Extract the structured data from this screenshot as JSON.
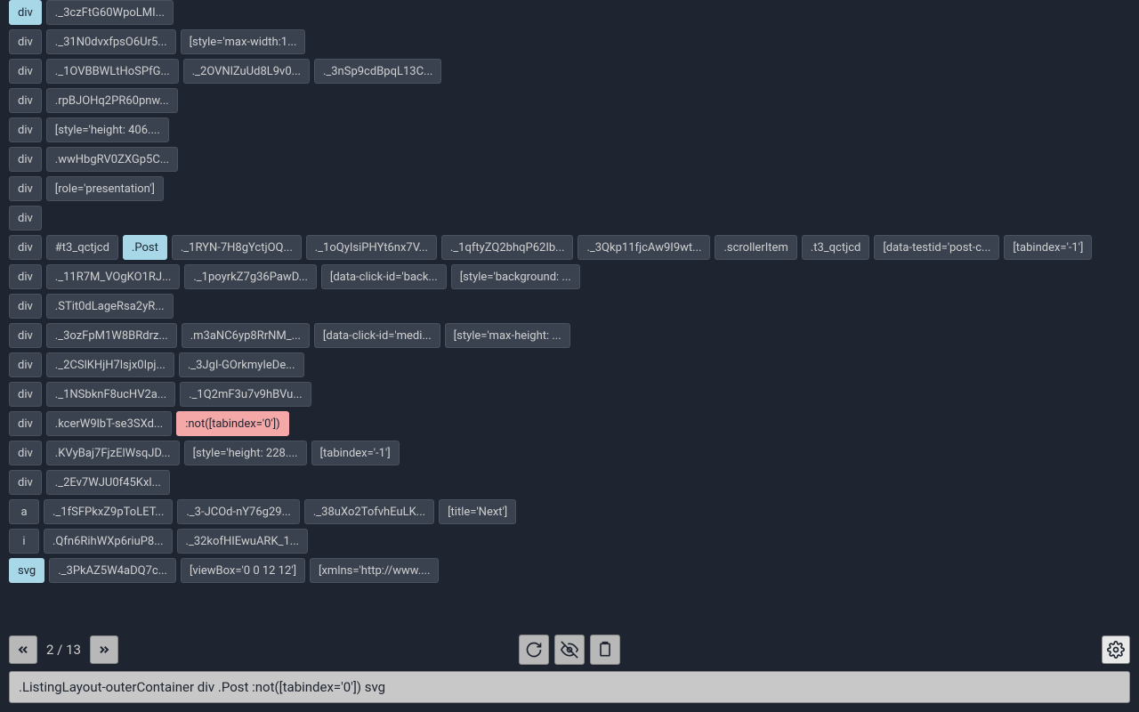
{
  "rows": [
    {
      "tag": "div",
      "tagHighlight": "blue",
      "chips": [
        {
          "text": "._3czFtG60WpoLMI..."
        }
      ]
    },
    {
      "tag": "div",
      "chips": [
        {
          "text": "._31N0dvxfpsO6Ur5..."
        },
        {
          "text": "[style='max-width:1..."
        }
      ]
    },
    {
      "tag": "div",
      "chips": [
        {
          "text": "._1OVBBWLtHoSPfG..."
        },
        {
          "text": "._2OVNlZuUd8L9v0..."
        },
        {
          "text": "._3nSp9cdBpqL13C..."
        }
      ]
    },
    {
      "tag": "div",
      "chips": [
        {
          "text": ".rpBJOHq2PR60pnw..."
        }
      ]
    },
    {
      "tag": "div",
      "chips": [
        {
          "text": "[style='height: 406...."
        }
      ]
    },
    {
      "tag": "div",
      "chips": [
        {
          "text": ".wwHbgRV0ZXGp5C..."
        }
      ]
    },
    {
      "tag": "div",
      "chips": [
        {
          "text": "[role='presentation']"
        }
      ]
    },
    {
      "tag": "div",
      "chips": []
    },
    {
      "tag": "div",
      "chips": [
        {
          "text": "#t3_qctjcd"
        },
        {
          "text": ".Post",
          "highlight": "blue"
        },
        {
          "text": "._1RYN-7H8gYctjOQ..."
        },
        {
          "text": "._1oQyIsiPHYt6nx7V..."
        },
        {
          "text": "._1qftyZQ2bhqP62Ib..."
        },
        {
          "text": "._3Qkp11fjcAw9I9wt..."
        },
        {
          "text": ".scrollerItem"
        },
        {
          "text": ".t3_qctjcd"
        },
        {
          "text": "[data-testid='post-c..."
        },
        {
          "text": "[tabindex='-1']"
        }
      ]
    },
    {
      "tag": "div",
      "chips": [
        {
          "text": "._11R7M_VOgKO1RJ..."
        },
        {
          "text": "._1poyrkZ7g36PawD..."
        },
        {
          "text": "[data-click-id='back..."
        },
        {
          "text": "[style='background: ..."
        }
      ]
    },
    {
      "tag": "div",
      "chips": [
        {
          "text": ".STit0dLageRsa2yR..."
        }
      ]
    },
    {
      "tag": "div",
      "chips": [
        {
          "text": "._3ozFpM1W8BRdrz..."
        },
        {
          "text": ".m3aNC6yp8RrNM_..."
        },
        {
          "text": "[data-click-id='medi..."
        },
        {
          "text": "[style='max-height: ..."
        }
      ]
    },
    {
      "tag": "div",
      "chips": [
        {
          "text": "._2CSlKHjH7lsjx0Ipj..."
        },
        {
          "text": "._3JgI-GOrkmyIeDe..."
        }
      ]
    },
    {
      "tag": "div",
      "chips": [
        {
          "text": "._1NSbknF8ucHV2a..."
        },
        {
          "text": "._1Q2mF3u7v9hBVu..."
        }
      ]
    },
    {
      "tag": "div",
      "chips": [
        {
          "text": ".kcerW9lbT-se3SXd..."
        },
        {
          "text": ":not([tabindex='0'])",
          "highlight": "red"
        }
      ]
    },
    {
      "tag": "div",
      "chips": [
        {
          "text": ".KVyBaj7FjzElWsqJD..."
        },
        {
          "text": "[style='height: 228...."
        },
        {
          "text": "[tabindex='-1']"
        }
      ]
    },
    {
      "tag": "div",
      "chips": [
        {
          "text": "._2Ev7WJU0f45Kxl..."
        }
      ]
    },
    {
      "tag": "a",
      "chips": [
        {
          "text": "._1fSFPkxZ9pToLET..."
        },
        {
          "text": "._3-JCOd-nY76g29..."
        },
        {
          "text": "._38uXo2TofvhEuLK..."
        },
        {
          "text": "[title='Next']"
        }
      ]
    },
    {
      "tag": "i",
      "chips": [
        {
          "text": ".Qfn6RihWXp6riuP8..."
        },
        {
          "text": "._32kofHIEwuARK_1..."
        }
      ]
    },
    {
      "tag": "svg",
      "tagHighlight": "blue",
      "chips": [
        {
          "text": "._3PkAZ5W4aDQ7c..."
        },
        {
          "text": "[viewBox='0 0 12 12']"
        },
        {
          "text": "[xmlns='http://www...."
        }
      ]
    }
  ],
  "pagination": {
    "current": "2",
    "separator": " / ",
    "total": "13"
  },
  "selector": ".ListingLayout-outerContainer div .Post :not([tabindex='0']) svg"
}
